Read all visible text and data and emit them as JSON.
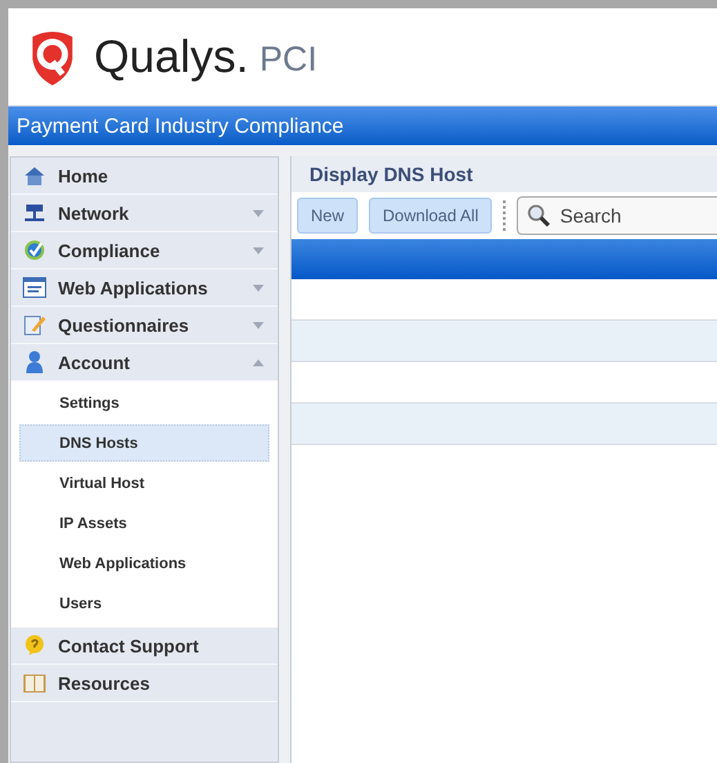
{
  "logo": {
    "brand": "Qualys.",
    "product": "PCI"
  },
  "banner": {
    "title": "Payment Card Industry Compliance"
  },
  "sidebar": {
    "items": [
      {
        "label": "Home"
      },
      {
        "label": "Network",
        "expanded": false
      },
      {
        "label": "Compliance",
        "expanded": false
      },
      {
        "label": "Web Applications",
        "expanded": false
      },
      {
        "label": "Questionnaires",
        "expanded": false
      },
      {
        "label": "Account",
        "expanded": true,
        "children": [
          {
            "label": "Settings",
            "selected": false
          },
          {
            "label": "DNS Hosts",
            "selected": true
          },
          {
            "label": "Virtual Host",
            "selected": false
          },
          {
            "label": "IP Assets",
            "selected": false
          },
          {
            "label": "Web Applications",
            "selected": false
          },
          {
            "label": "Users",
            "selected": false
          }
        ]
      },
      {
        "label": "Contact Support"
      },
      {
        "label": "Resources"
      }
    ]
  },
  "panel": {
    "title": "Display DNS Host",
    "buttons": [
      "New",
      "Download All"
    ],
    "search": {
      "placeholder": "Search"
    }
  }
}
